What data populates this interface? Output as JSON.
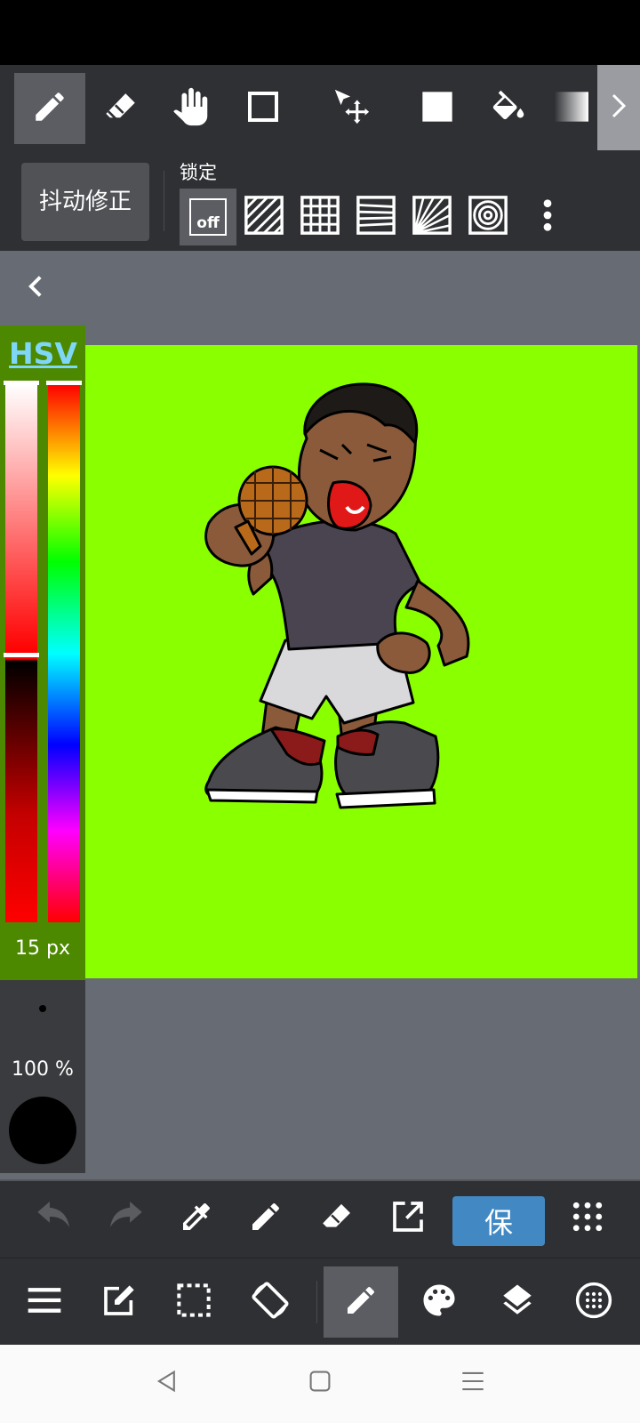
{
  "toolbar": {
    "tools": [
      {
        "name": "pencil-icon",
        "active": true
      },
      {
        "name": "eraser-icon",
        "active": false
      },
      {
        "name": "hand-icon",
        "active": false
      },
      {
        "name": "rectangle-icon",
        "active": false
      },
      {
        "name": "move-transform-icon",
        "active": false
      },
      {
        "name": "fill-shape-icon",
        "active": false
      },
      {
        "name": "bucket-icon",
        "active": false
      },
      {
        "name": "gradient-icon",
        "active": false
      }
    ],
    "next_icon": "chevron-right-icon"
  },
  "stabilizer": {
    "label": "抖动修正"
  },
  "lock": {
    "label": "锁定",
    "off_label": "off",
    "options": [
      "off",
      "diagonal",
      "grid",
      "horizontal-perspective",
      "radial",
      "concentric"
    ]
  },
  "color_panel": {
    "mode_label": "HSV",
    "brush_size": "15 px",
    "opacity": "100 %",
    "current_color": "#000000",
    "hue_level": 0.0,
    "saturation_level": 1.0,
    "value_level": 0.49
  },
  "canvas": {
    "background_color": "#8aff00"
  },
  "bottom_toolbar": {
    "save_label": "保"
  },
  "colors": {
    "toolbar_bg": "#2f3033",
    "active_bg": "#5b5d62",
    "save_blue": "#4289c4",
    "hsv_link": "#7fd7f7"
  }
}
